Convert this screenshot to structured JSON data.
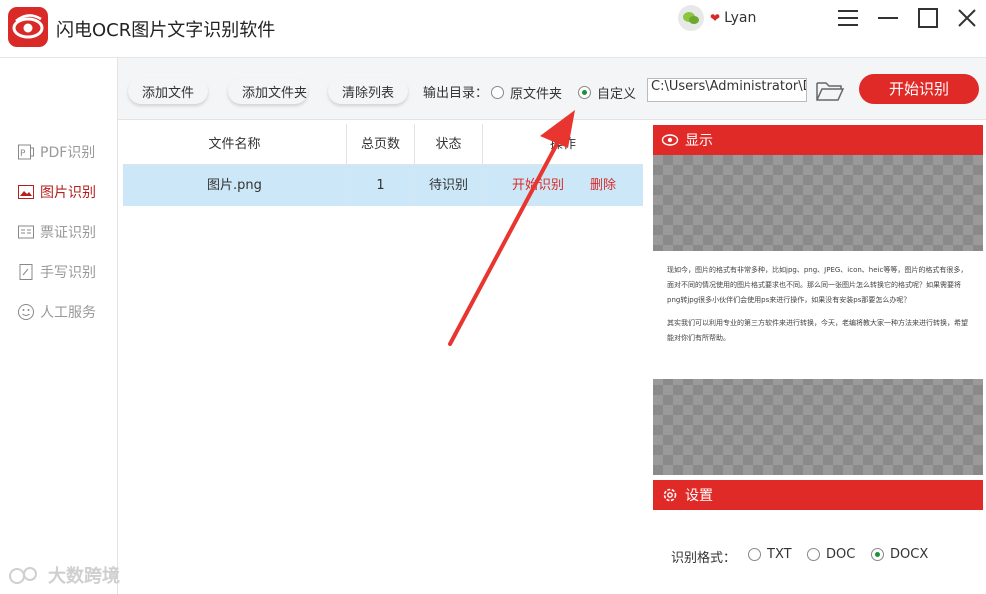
{
  "app": {
    "title": "闪电OCR图片文字识别软件",
    "user": "Lyan"
  },
  "sidebar": {
    "items": [
      {
        "label": "PDF识别",
        "icon": "pdf-icon",
        "active": false
      },
      {
        "label": "图片识别",
        "icon": "image-icon",
        "active": true
      },
      {
        "label": "票证识别",
        "icon": "card-icon",
        "active": false
      },
      {
        "label": "手写识别",
        "icon": "handwrite-icon",
        "active": false
      },
      {
        "label": "人工服务",
        "icon": "smile-icon",
        "active": false
      }
    ]
  },
  "toolbar": {
    "add_file": "添加文件",
    "add_folder": "添加文件夹",
    "clear_list": "清除列表",
    "output_label": "输出目录：",
    "opt_original": "原文件夹",
    "opt_custom": "自定义",
    "selected_output": "自定义",
    "path_value": "C:\\Users\\Administrator\\De",
    "start": "开始识别"
  },
  "table": {
    "columns": [
      "文件名称",
      "总页数",
      "状态",
      "操作"
    ],
    "rows": [
      {
        "name": "图片.png",
        "pages": "1",
        "status": "待识别",
        "action_start": "开始识别",
        "action_delete": "删除"
      }
    ]
  },
  "preview": {
    "title": "显示",
    "paragraph1": "现如今，图片的格式有非常多种，比如jpg、png、JPEG、icon、heic等等，图片的格式有很多，面对不同的情况使用的图片格式要求也不同。那么同一张图片怎么转换它的格式呢？如果需要将png转jpg很多小伙伴们会使用ps来进行操作，如果没有安装ps那要怎么办呢？",
    "paragraph2": "其实我们可以利用专业的第三方软件来进行转换，今天，老编将教大家一种方法来进行转换，希望能对你们有所帮助。"
  },
  "settings": {
    "title": "设置",
    "format_label": "识别格式：",
    "formats": [
      "TXT",
      "DOC",
      "DOCX"
    ],
    "selected": "DOCX"
  },
  "watermark": {
    "text": "大数跨境"
  },
  "colors": {
    "accent": "#e02a28",
    "row_highlight": "#cce8f8",
    "radio_on": "#1e8f3a"
  }
}
